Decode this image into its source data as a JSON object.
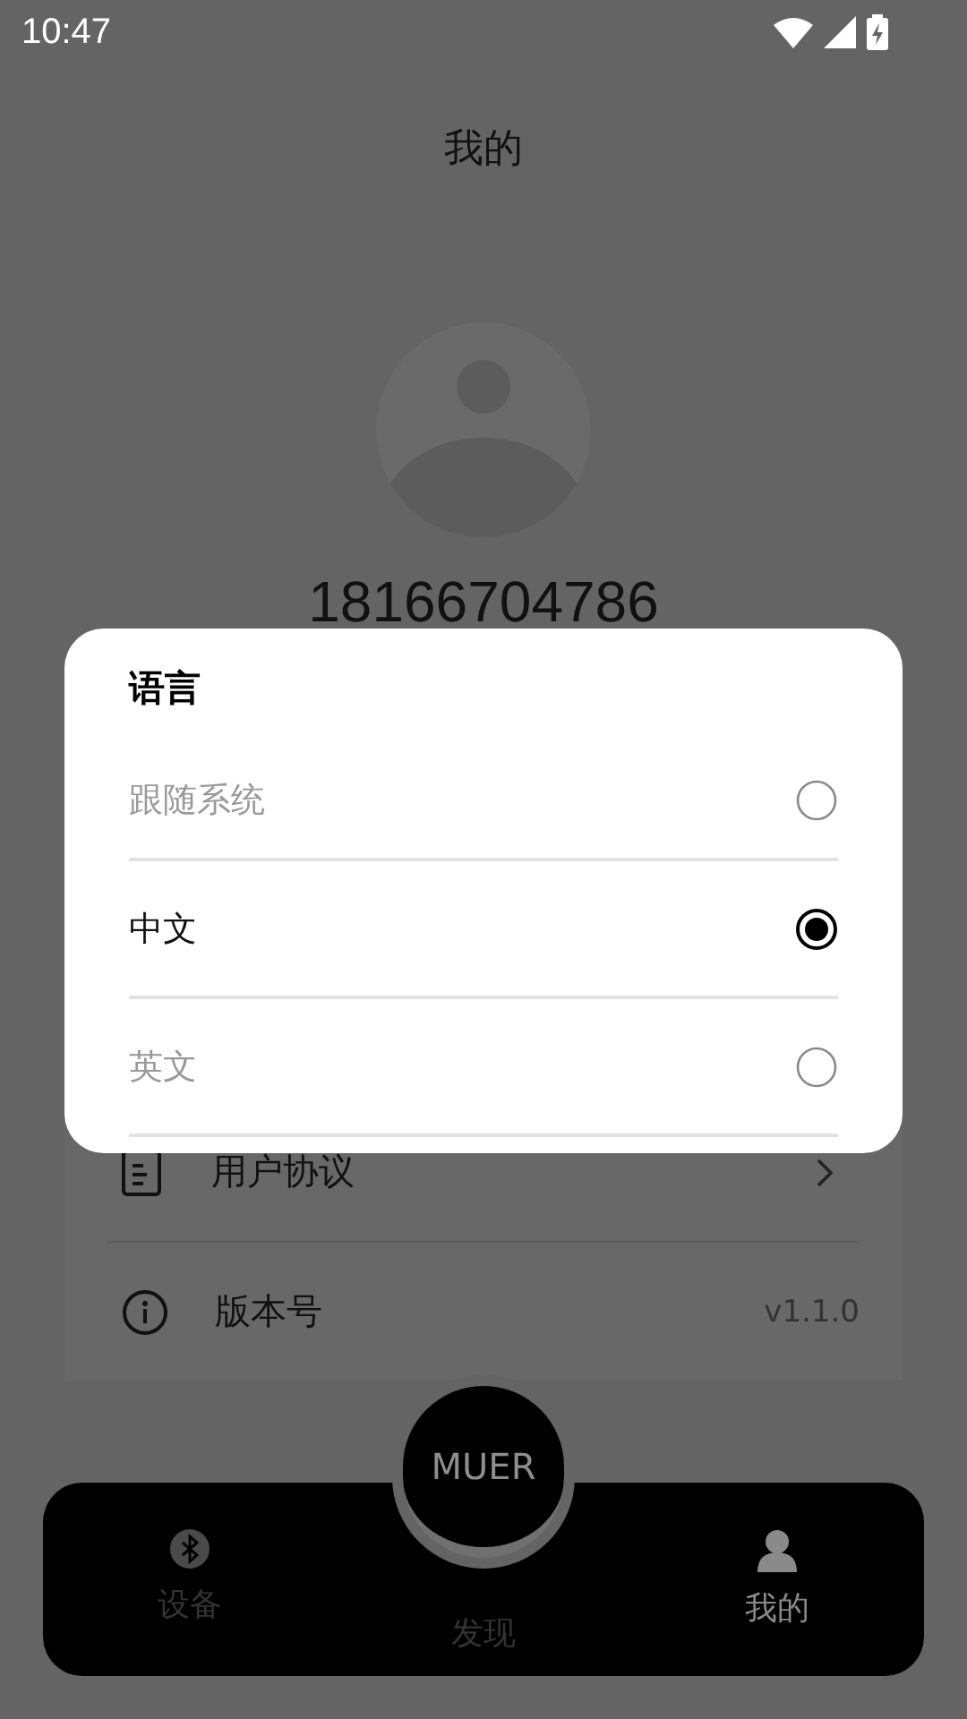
{
  "status_bar": {
    "time": "10:47"
  },
  "header": {
    "title": "我的"
  },
  "profile": {
    "phone": "18166704786"
  },
  "menu": [
    {
      "label": "用户协议",
      "kind": "link"
    },
    {
      "label": "版本号",
      "kind": "value",
      "value": "v1.1.0"
    }
  ],
  "dialog": {
    "title": "语言",
    "options": [
      {
        "label": "跟随系统",
        "selected": false
      },
      {
        "label": "中文",
        "selected": true
      },
      {
        "label": "英文",
        "selected": false
      }
    ]
  },
  "center_button": {
    "label": "MUER"
  },
  "nav": [
    {
      "label": "设备",
      "selected": false
    },
    {
      "label": "发现",
      "selected": false
    },
    {
      "label": "我的",
      "selected": true
    }
  ]
}
